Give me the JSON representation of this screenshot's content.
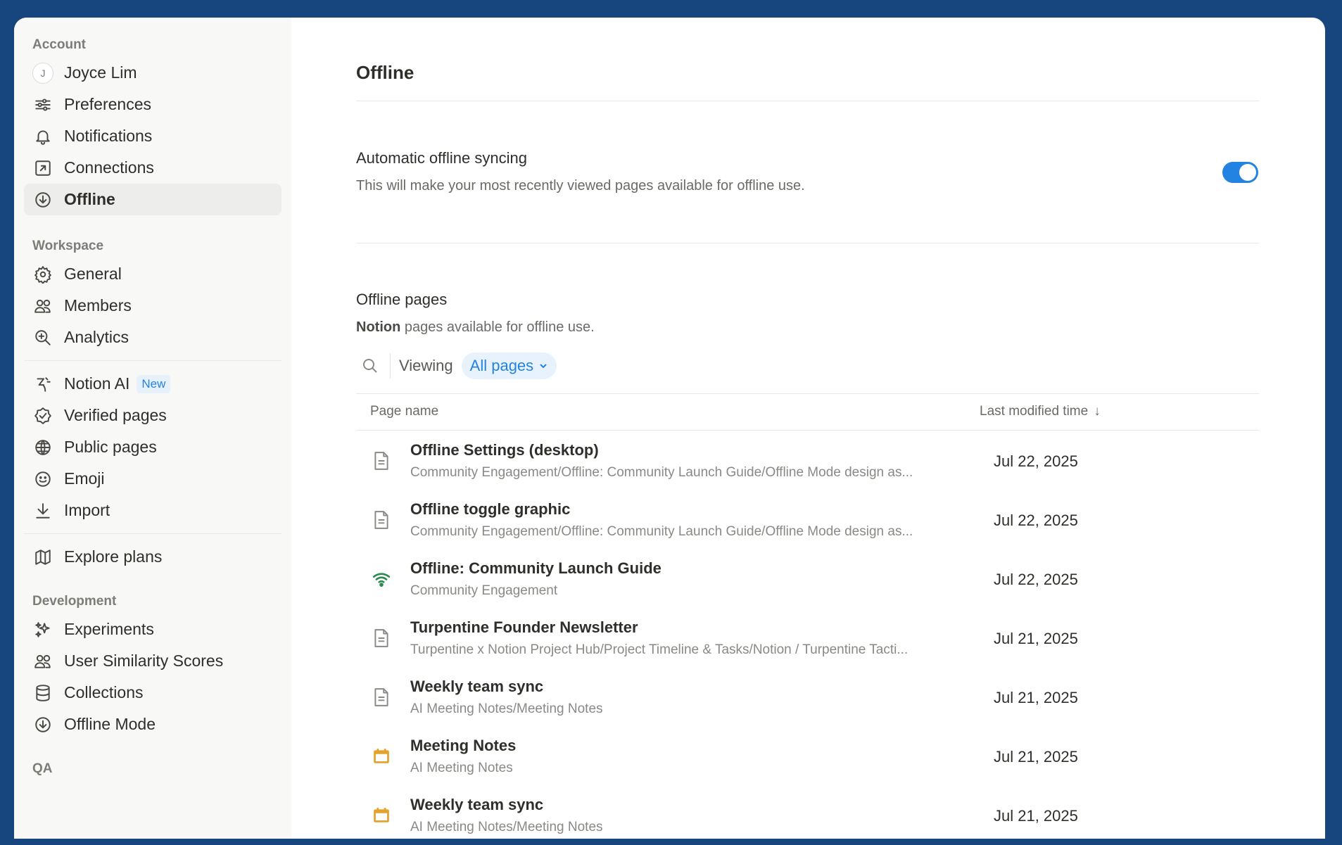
{
  "sidebar": {
    "account_label": "Account",
    "account_items": [
      {
        "label": "Joyce Lim",
        "avatar_letter": "J"
      },
      {
        "label": "Preferences"
      },
      {
        "label": "Notifications"
      },
      {
        "label": "Connections"
      },
      {
        "label": "Offline"
      }
    ],
    "workspace_label": "Workspace",
    "workspace_items": [
      {
        "label": "General"
      },
      {
        "label": "Members"
      },
      {
        "label": "Analytics"
      }
    ],
    "feature_items": [
      {
        "label": "Notion AI",
        "badge": "New"
      },
      {
        "label": "Verified pages"
      },
      {
        "label": "Public pages"
      },
      {
        "label": "Emoji"
      },
      {
        "label": "Import"
      }
    ],
    "plans_item": {
      "label": "Explore plans"
    },
    "development_label": "Development",
    "development_items": [
      {
        "label": "Experiments"
      },
      {
        "label": "User Similarity Scores"
      },
      {
        "label": "Collections"
      },
      {
        "label": "Offline Mode"
      }
    ],
    "qa_label": "QA"
  },
  "main": {
    "title": "Offline",
    "auto_sync": {
      "title": "Automatic offline syncing",
      "description": "This will make your most recently viewed pages available for offline use.",
      "enabled": true
    },
    "offline_pages": {
      "title": "Offline pages",
      "desc_bold": "Notion",
      "desc_rest": " pages available for offline use.",
      "viewing_label": "Viewing",
      "filter_value": "All pages",
      "columns": {
        "name": "Page name",
        "modified": "Last modified time",
        "sort_arrow": "↓"
      },
      "rows": [
        {
          "icon": "page-icon",
          "name": "Offline Settings (desktop)",
          "path": "Community Engagement/Offline: Community Launch Guide/Offline Mode design as...",
          "date": "Jul 22, 2025"
        },
        {
          "icon": "page-icon",
          "name": "Offline toggle graphic",
          "path": "Community Engagement/Offline: Community Launch Guide/Offline Mode design as...",
          "date": "Jul 22, 2025"
        },
        {
          "icon": "wifi-icon",
          "name": "Offline: Community Launch Guide",
          "path": "Community Engagement",
          "date": "Jul 22, 2025"
        },
        {
          "icon": "page-icon",
          "name": "Turpentine Founder Newsletter",
          "path": "Turpentine x Notion Project Hub/Project Timeline & Tasks/Notion / Turpentine Tacti...",
          "date": "Jul 21, 2025"
        },
        {
          "icon": "page-icon",
          "name": "Weekly team sync",
          "path": "AI Meeting Notes/Meeting Notes",
          "date": "Jul 21, 2025"
        },
        {
          "icon": "calendar-icon",
          "name": "Meeting Notes",
          "path": "AI Meeting Notes",
          "date": "Jul 21, 2025"
        },
        {
          "icon": "calendar-icon",
          "name": "Weekly team sync",
          "path": "AI Meeting Notes/Meeting Notes",
          "date": "Jul 21, 2025"
        }
      ]
    }
  },
  "colors": {
    "frame": "#17457e",
    "accent": "#2383e2",
    "calendar_icon": "#e3a22b",
    "wifi_icon": "#2b8a4f"
  }
}
